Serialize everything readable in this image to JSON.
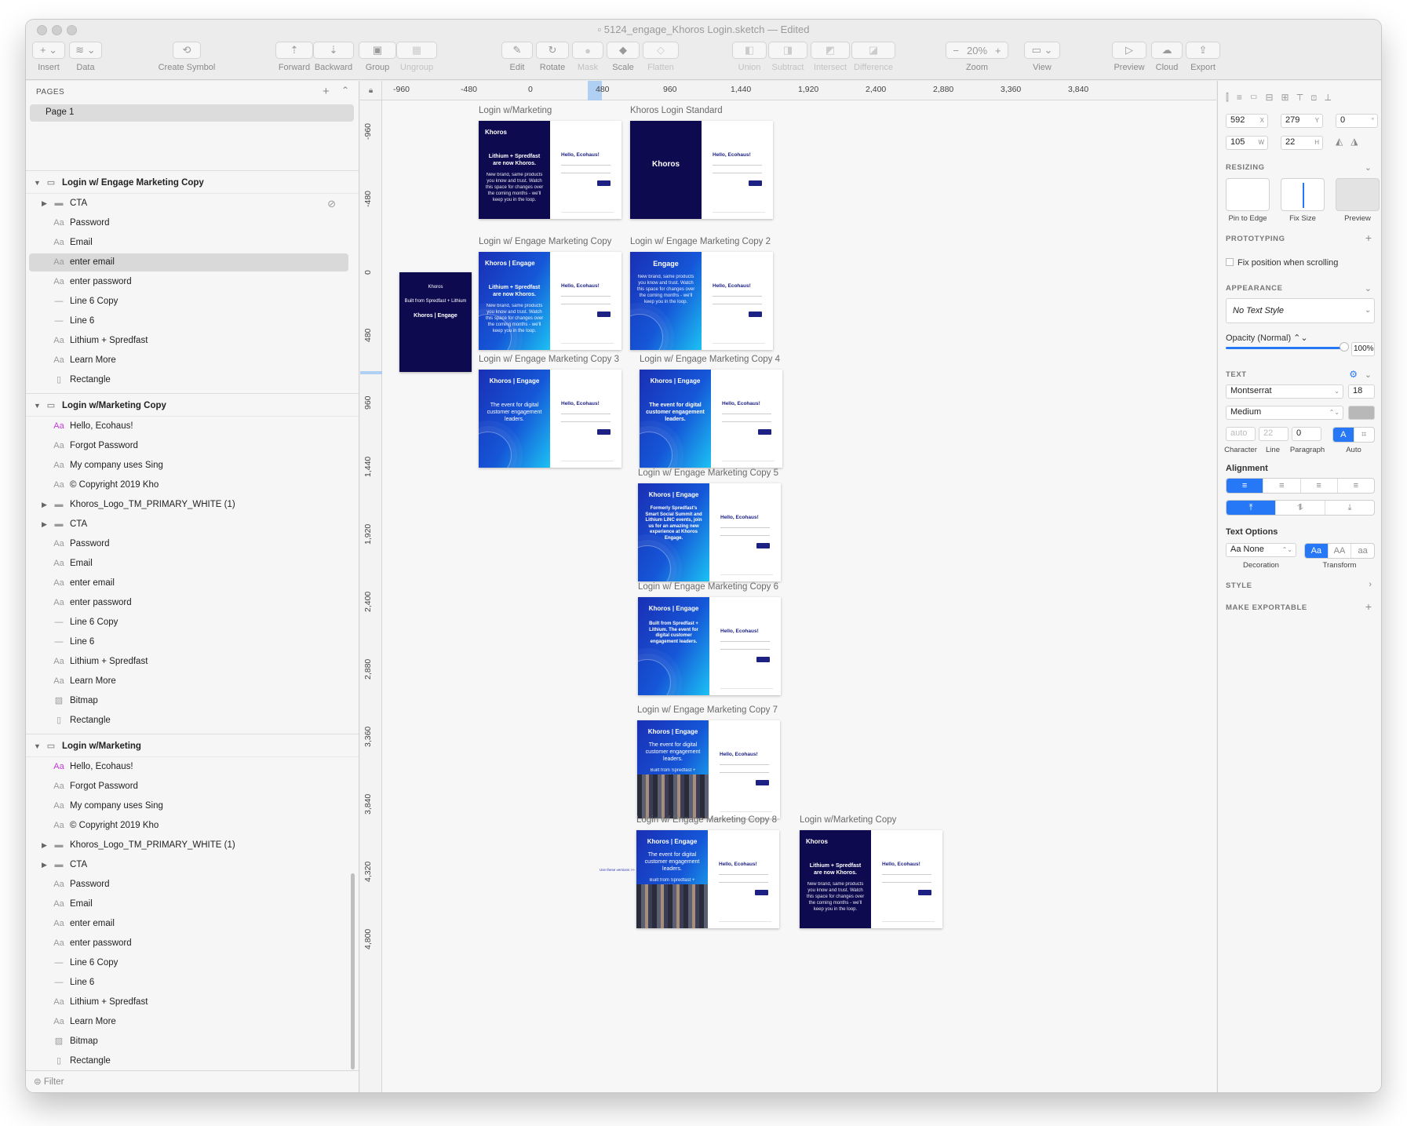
{
  "window": {
    "title": "5124_engage_Khoros Login.sketch",
    "edited": "— Edited"
  },
  "toolbar": {
    "insert": "Insert",
    "data": "Data",
    "create_symbol": "Create Symbol",
    "forward": "Forward",
    "backward": "Backward",
    "group": "Group",
    "ungroup": "Ungroup",
    "edit": "Edit",
    "rotate": "Rotate",
    "mask": "Mask",
    "scale": "Scale",
    "flatten": "Flatten",
    "union": "Union",
    "subtract": "Subtract",
    "intersect": "Intersect",
    "difference": "Difference",
    "zoom": "Zoom",
    "zoom_value": "20%",
    "view": "View",
    "preview": "Preview",
    "cloud": "Cloud",
    "export": "Export"
  },
  "pages": {
    "header": "PAGES",
    "items": [
      "Page 1"
    ]
  },
  "layers": {
    "group1": {
      "name": "Login w/ Engage Marketing Copy",
      "items": [
        "CTA",
        "Password",
        "Email",
        "enter email",
        "enter password",
        "Line 6 Copy",
        "Line 6",
        "Lithium + Spredfast",
        "Learn More",
        "Rectangle"
      ]
    },
    "group2": {
      "name": "Login w/Marketing Copy",
      "items": [
        "Hello, Ecohaus!",
        "Forgot Password",
        "My company uses Sing",
        "© Copyright 2019 Kho",
        "Khoros_Logo_TM_PRIMARY_WHITE (1)",
        "CTA",
        "Password",
        "Email",
        "enter email",
        "enter password",
        "Line 6 Copy",
        "Line 6",
        "Lithium + Spredfast",
        "Learn More",
        "Bitmap",
        "Rectangle"
      ]
    },
    "group3": {
      "name": "Login w/Marketing",
      "items": [
        "Hello, Ecohaus!",
        "Forgot Password",
        "My company uses Sing",
        "© Copyright 2019 Kho",
        "Khoros_Logo_TM_PRIMARY_WHITE (1)",
        "CTA",
        "Password",
        "Email",
        "enter email",
        "enter password",
        "Line 6 Copy",
        "Line 6",
        "Lithium + Spredfast",
        "Learn More",
        "Bitmap",
        "Rectangle"
      ]
    },
    "filter": "Filter"
  },
  "ruler": {
    "h": [
      "-960",
      "-480",
      "0",
      "480",
      "960",
      "1,440",
      "1,920",
      "2,400",
      "2,880",
      "3,360",
      "3,840"
    ],
    "v": [
      "-960",
      "-480",
      "0",
      "480",
      "960",
      "1,440",
      "1,920",
      "2,400",
      "2,880",
      "3,360",
      "3,840",
      "4,320",
      "4,800"
    ]
  },
  "artboards": {
    "a1": {
      "label": "Login w/Marketing",
      "logo": "Khoros",
      "head": "Lithium + Spredfast are now Khoros.",
      "sub": "New brand, same products you know and trust. Watch this space for changes over the coming months - we'll keep you in the loop.",
      "hello": "Hello, Ecohaus!"
    },
    "a2": {
      "label": "Khoros Login Standard",
      "logo": "Khoros",
      "hello": "Hello, Ecohaus!"
    },
    "a3": {
      "label": "Login w/ Engage Marketing Copy",
      "logo": "Khoros | Engage",
      "head": "Lithium + Spredfast are now Khoros.",
      "sub": "New brand, same products you know and trust. Watch this space for changes over the coming months - we'll keep you in the loop.",
      "hello": "Hello, Ecohaus!"
    },
    "a4": {
      "label": "Login w/ Engage Marketing Copy 2",
      "logo": "Engage",
      "sub": "New brand, same products you know and trust. Watch this space for changes over the coming months - we'll keep you in the loop.",
      "hello": "Hello, Ecohaus!"
    },
    "a5": {
      "label": "Login w/ Engage Marketing Copy 3",
      "logo": "Khoros | Engage",
      "head": "The event for digital customer engagement leaders.",
      "hello": "Hello, Ecohaus!"
    },
    "a6": {
      "label": "Login w/ Engage Marketing Copy 4",
      "logo": "Khoros | Engage",
      "head": "The event for digital customer engagement leaders.",
      "hello": "Hello, Ecohaus!"
    },
    "a7": {
      "label": "Login w/ Engage Marketing Copy 5",
      "logo": "Khoros | Engage",
      "head": "Formerly Spredfast's Smart Social Summit and Lithium LiNC events, join us for an amazing new experience at Khoros Engage.",
      "hello": "Hello, Ecohaus!"
    },
    "a8": {
      "label": "Login w/ Engage Marketing Copy 6",
      "logo": "Khoros | Engage",
      "head": "Built from Spredfast + Lithium. The event for digital customer engagement leaders.",
      "hello": "Hello, Ecohaus!"
    },
    "a9": {
      "label": "Login w/ Engage Marketing Copy 7",
      "logo": "Khoros | Engage",
      "head": "The event for digital customer engagement leaders.",
      "sub": "Built from Spredfast + Lithium",
      "hello": "Hello, Ecohaus!"
    },
    "a10": {
      "label": "Login w/ Engage Marketing Copy 8",
      "logo": "Khoros | Engage",
      "head": "The event for digital customer engagement leaders.",
      "sub": "Built from Spredfast + Lithium",
      "hello": "Hello, Ecohaus!"
    },
    "a11": {
      "label": "Login w/Marketing Copy",
      "logo": "Khoros",
      "head": "Lithium + Spredfast are now Khoros.",
      "sub": "New brand, same products you know and trust. Watch this space for changes over the coming months - we'll keep you in the loop.",
      "hello": "Hello, Ecohaus!"
    },
    "lonely": {
      "l1": "Khoros",
      "l2": "Built from Spredfast + Lithium",
      "l3": "Khoros | Engage"
    },
    "link": "Use these versions >>"
  },
  "inspector": {
    "x": "592",
    "y": "279",
    "r": "0",
    "w": "105",
    "h": "22",
    "x_u": "X",
    "y_u": "Y",
    "r_u": "°",
    "w_u": "W",
    "h_u": "H",
    "resizing": "RESIZING",
    "pin": "Pin to Edge",
    "fix": "Fix Size",
    "preview": "Preview",
    "prototyping": "PROTOTYPING",
    "fixpos": "Fix position when scrolling",
    "appearance": "APPEARANCE",
    "textstyle": "No Text Style",
    "opacity": "Opacity (Normal)",
    "opacity_val": "100%",
    "text": "TEXT",
    "font": "Montserrat",
    "size": "18",
    "weight": "Medium",
    "char": "auto",
    "line": "22",
    "para": "0",
    "char_l": "Character",
    "line_l": "Line",
    "para_l": "Paragraph",
    "auto_l": "Auto",
    "alignment": "Alignment",
    "textopts": "Text Options",
    "deco": "Aa None",
    "deco_l": "Decoration",
    "tr1": "Aa",
    "tr2": "AA",
    "tr3": "aa",
    "tr_l": "Transform",
    "style": "STYLE",
    "exportable": "MAKE EXPORTABLE"
  }
}
